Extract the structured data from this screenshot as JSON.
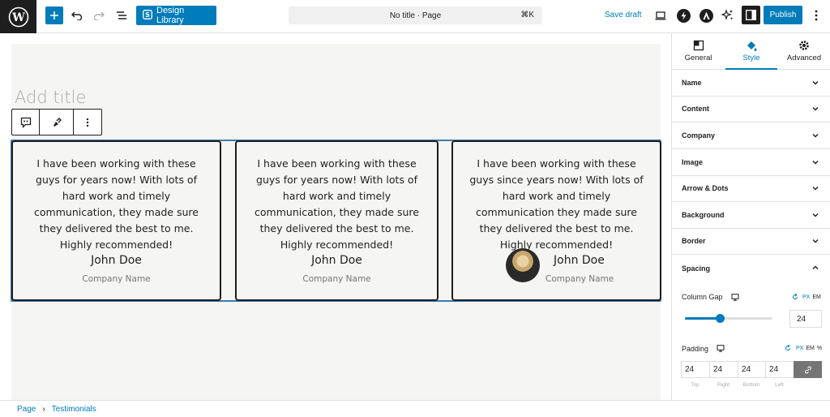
{
  "topbar": {
    "design_library_label": "Design Library",
    "document_title": "No title · Page",
    "shortcut": "⌘K",
    "save_draft_label": "Save draft",
    "publish_label": "Publish"
  },
  "editor": {
    "title_placeholder": "Add title"
  },
  "testimonials": [
    {
      "quote": "I have been working with these guys for years now! With lots of hard work and timely communication, they made sure they delivered the best to me. Highly recommended!",
      "name": "John Doe",
      "company": "Company Name",
      "has_avatar": false
    },
    {
      "quote": "I have been working with these guys for years now! With lots of hard work and timely communication, they made sure they delivered the best to me. Highly recommended!",
      "name": "John Doe",
      "company": "Company Name",
      "has_avatar": false
    },
    {
      "quote": "I have been working with these guys since years now! With lots of hard work and timely communication they made sure they delivered the best to me. Highly recommended!",
      "name": "John Doe",
      "company": "Company Name",
      "has_avatar": true
    }
  ],
  "sidebar": {
    "tabs": [
      {
        "label": "General",
        "icon": "layout-icon"
      },
      {
        "label": "Style",
        "icon": "paint-bucket-icon"
      },
      {
        "label": "Advanced",
        "icon": "gear-icon"
      }
    ],
    "panels": [
      "Name",
      "Content",
      "Company",
      "Image",
      "Arrow & Dots",
      "Background",
      "Border",
      "Spacing"
    ],
    "spacing": {
      "column_gap_label": "Column Gap",
      "column_gap_units": [
        "PX",
        "EM"
      ],
      "column_gap_value": "24",
      "column_gap_slider_fraction": 0.4,
      "padding_label": "Padding",
      "padding_units": [
        "PX",
        "EM",
        "%"
      ],
      "padding_values": [
        "24",
        "24",
        "24",
        "24"
      ],
      "padding_sides": [
        "Top",
        "Right",
        "Bottom",
        "Left"
      ]
    }
  },
  "breadcrumb": [
    "Page",
    "Testimonials"
  ],
  "colors": {
    "accent": "#007cba",
    "dark": "#1e1e1e",
    "canvas": "#f5f5f3"
  }
}
